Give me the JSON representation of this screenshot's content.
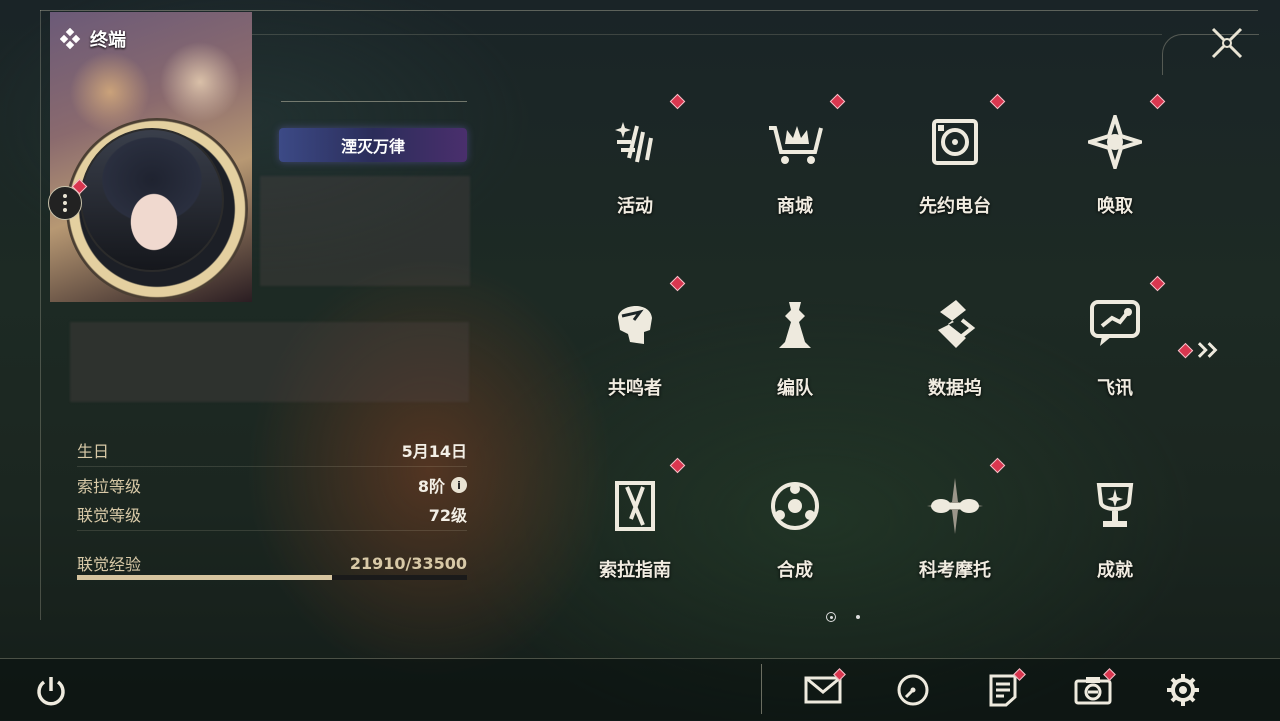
{
  "header": {
    "title": "终端"
  },
  "profile": {
    "title_badge": "湮灭万律"
  },
  "stats": [
    {
      "label": "生日",
      "value": "5月14日"
    },
    {
      "label": "索拉等级",
      "value": "8阶"
    },
    {
      "label": "联觉等级",
      "value": "72级"
    }
  ],
  "experience": {
    "label": "联觉经验",
    "value": "21910/33500",
    "progress": 0.654
  },
  "menu": [
    {
      "label": "活动",
      "icon": "activity-icon",
      "badge": true
    },
    {
      "label": "商城",
      "icon": "shop-cart-icon",
      "badge": true
    },
    {
      "label": "先约电台",
      "icon": "radio-icon",
      "badge": true
    },
    {
      "label": "唤取",
      "icon": "summon-compass-icon",
      "badge": true
    },
    {
      "label": "共鸣者",
      "icon": "resonator-head-icon",
      "badge": true
    },
    {
      "label": "编队",
      "icon": "team-chess-icon",
      "badge": false
    },
    {
      "label": "数据坞",
      "icon": "data-dock-icon",
      "badge": false
    },
    {
      "label": "飞讯",
      "icon": "message-chat-icon",
      "badge": true
    },
    {
      "label": "索拉指南",
      "icon": "guide-book-icon",
      "badge": true
    },
    {
      "label": "合成",
      "icon": "synthesis-icon",
      "badge": false
    },
    {
      "label": "科考摩托",
      "icon": "motorbike-icon",
      "badge": true
    },
    {
      "label": "成就",
      "icon": "trophy-icon",
      "badge": false
    }
  ],
  "pagination": {
    "current": 1,
    "total": 2
  },
  "bottom_icons": [
    "mail-icon",
    "clock-icon",
    "notes-icon",
    "camera-icon",
    "gear-icon"
  ],
  "colors": {
    "accent": "#d9364f",
    "gold": "#d6c49f",
    "text": "#f1ece1"
  }
}
